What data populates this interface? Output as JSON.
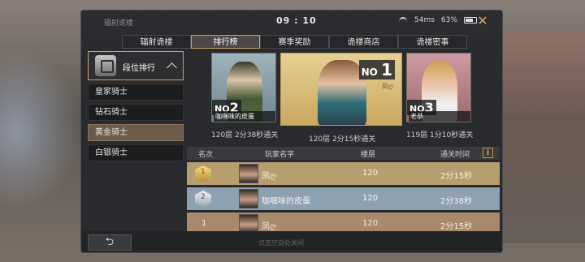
{
  "window": {
    "title": "辐射诡楼",
    "clock": "09 : 10",
    "signal": "54ms",
    "battery": "63%"
  },
  "tabs": [
    {
      "label": "辐射诡楼"
    },
    {
      "label": "排行榜"
    },
    {
      "label": "赛季奖励"
    },
    {
      "label": "诡楼商店"
    },
    {
      "label": "诡楼密事"
    }
  ],
  "sidebar": {
    "header": "段位排行",
    "items": [
      {
        "label": "皇家骑士"
      },
      {
        "label": "钻石骑士"
      },
      {
        "label": "黄金骑士"
      },
      {
        "label": "白银骑士"
      }
    ]
  },
  "podium": {
    "first": {
      "tag": "NO",
      "rank": "1",
      "name": "凤ღ",
      "time": "120层 2分15秒通关"
    },
    "second": {
      "tag": "NO",
      "rank": "2",
      "name": "咖喱味的皮蛋",
      "time": "120层 2分38秒通关"
    },
    "third": {
      "tag": "NO",
      "rank": "3",
      "name": "老恭",
      "time": "119层 1分10秒通关"
    }
  },
  "table": {
    "headers": {
      "rank": "名次",
      "player": "玩家名字",
      "floor": "楼层",
      "time": "通关时间"
    },
    "rows": [
      {
        "rank": "1",
        "name": "凤ღ",
        "floor": "120",
        "time": "2分15秒"
      },
      {
        "rank": "2",
        "name": "咖喱味的皮蛋",
        "floor": "120",
        "time": "2分38秒"
      },
      {
        "rank": "1",
        "name": "凤ღ",
        "floor": "120",
        "time": "2分15秒"
      }
    ]
  },
  "footer": {
    "hint": "点击空白处关闭"
  },
  "colors": {
    "accent": "#c9a46a",
    "gold_row": "#b79e6f",
    "silver_row": "#8ea1b0",
    "bronze_row": "#a8896c"
  }
}
